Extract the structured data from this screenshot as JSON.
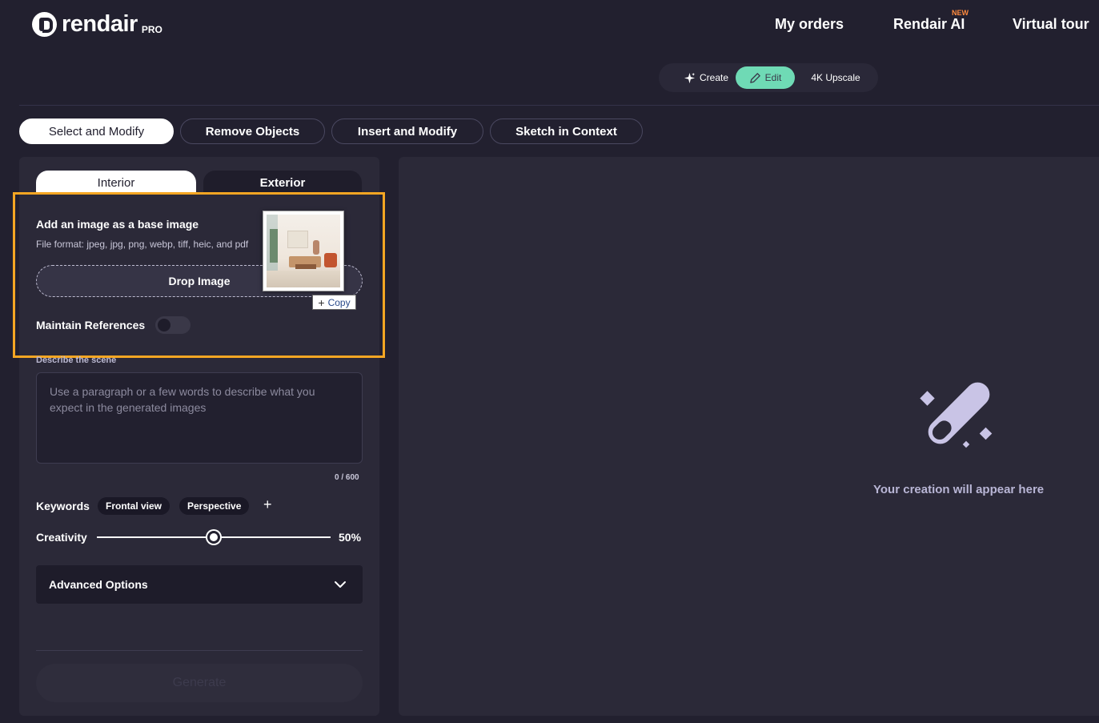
{
  "header": {
    "logo_text": "rendair",
    "logo_badge": "PRO",
    "nav": {
      "my_orders": "My orders",
      "rendair_ai": "Rendair AI",
      "new_badge": "NEW",
      "virtual_tour": "Virtual tour"
    }
  },
  "mode_switch": {
    "create": "Create",
    "edit": "Edit",
    "upscale": "4K Upscale",
    "active": "Edit",
    "active_color": "#6fdab5"
  },
  "tabs": [
    {
      "label": "Select and Modify",
      "active": true
    },
    {
      "label": "Remove Objects",
      "active": false
    },
    {
      "label": "Insert and Modify",
      "active": false
    },
    {
      "label": "Sketch in Context",
      "active": false
    }
  ],
  "left_panel": {
    "segments": {
      "interior": "Interior",
      "exterior": "Exterior",
      "active": "Interior"
    },
    "base_image": {
      "title": "Add an image as a base image",
      "formats": "File format: jpeg, jpg, png, webp, tiff, heic, and pdf",
      "drop_label": "Drop Image",
      "drag_copy_label": "Copy"
    },
    "maintain_references": {
      "label": "Maintain References",
      "enabled": false
    },
    "scene": {
      "label": "Describe the scene",
      "placeholder": "Use a paragraph or a few words to describe what you expect in the generated images",
      "value": "",
      "char_count": "0 / 600"
    },
    "keywords": {
      "label": "Keywords",
      "items": [
        "Frontal view",
        "Perspective"
      ]
    },
    "creativity": {
      "label": "Creativity",
      "value_label": "50%",
      "value": 0.5
    },
    "advanced_options": "Advanced Options",
    "generate": "Generate"
  },
  "right_panel": {
    "empty_text": "Your creation will appear here",
    "icon": "magic-wand-icon"
  },
  "colors": {
    "background": "#22202f",
    "panel": "#2b2938",
    "highlight": "#f5a623",
    "accent": "#6fdab5",
    "new_badge": "#ff8a3d"
  }
}
